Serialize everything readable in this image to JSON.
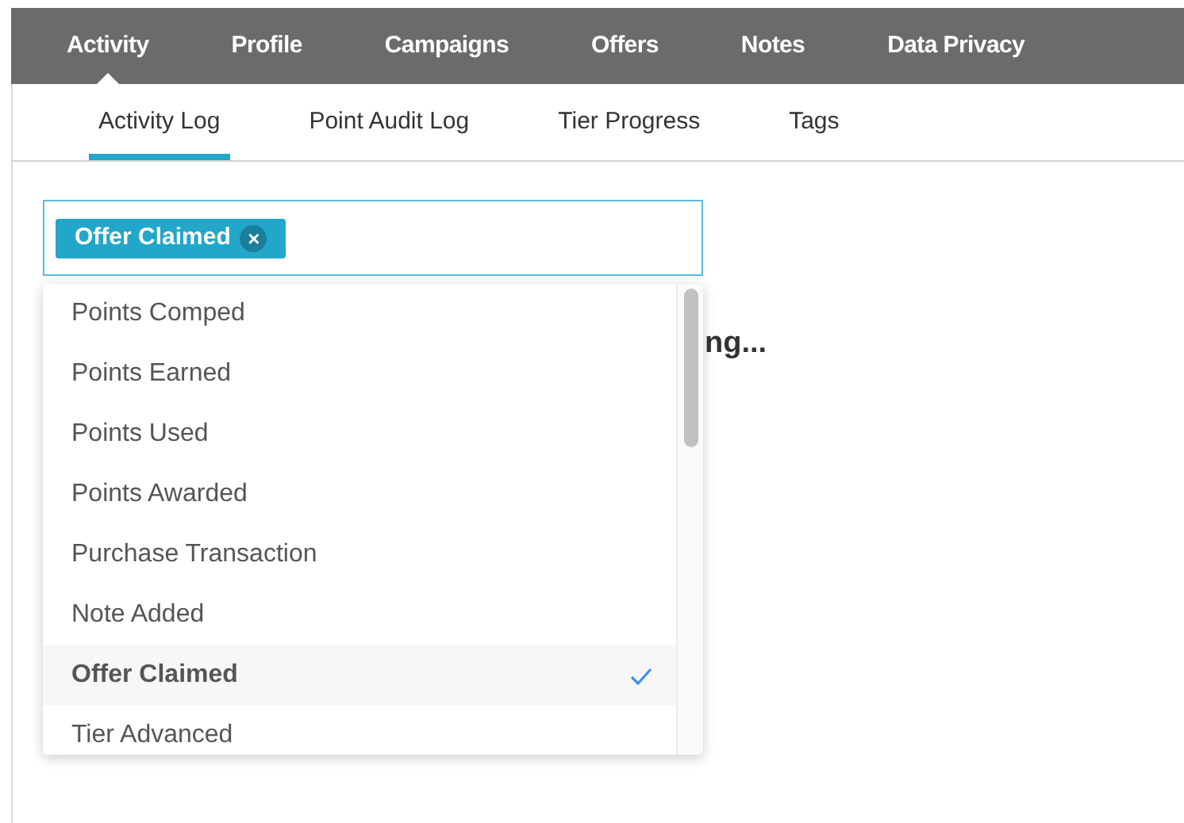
{
  "main_tabs": [
    {
      "label": "Activity",
      "selected": true
    },
    {
      "label": "Profile",
      "selected": false
    },
    {
      "label": "Campaigns",
      "selected": false
    },
    {
      "label": "Offers",
      "selected": false
    },
    {
      "label": "Notes",
      "selected": false
    },
    {
      "label": "Data Privacy",
      "selected": false
    }
  ],
  "sub_tabs": [
    {
      "label": "Activity Log",
      "selected": true
    },
    {
      "label": "Point Audit Log",
      "selected": false
    },
    {
      "label": "Tier Progress",
      "selected": false
    },
    {
      "label": "Tags",
      "selected": false
    }
  ],
  "filter": {
    "tags": [
      {
        "label": "Offer Claimed",
        "remove": "×"
      }
    ]
  },
  "dropdown": {
    "options": [
      {
        "label": "Points Comped",
        "selected": false
      },
      {
        "label": "Points Earned",
        "selected": false
      },
      {
        "label": "Points Used",
        "selected": false
      },
      {
        "label": "Points Awarded",
        "selected": false
      },
      {
        "label": "Purchase Transaction",
        "selected": false
      },
      {
        "label": "Note Added",
        "selected": false
      },
      {
        "label": "Offer Claimed",
        "selected": true
      },
      {
        "label": "Tier Advanced",
        "selected": false
      }
    ]
  },
  "status_text": "ng..."
}
